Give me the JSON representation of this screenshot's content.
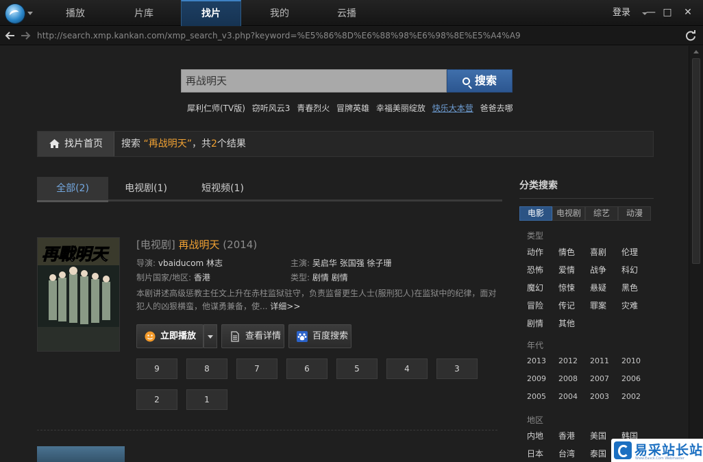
{
  "nav": {
    "tabs": [
      "播放",
      "片库",
      "找片",
      "我的",
      "云播"
    ],
    "active": "找片",
    "login": "登录"
  },
  "window_controls": {
    "minimize": "—",
    "maximize": "□",
    "close": "✕"
  },
  "address": {
    "url": "http://search.xmp.kankan.com/xmp_search_v3.php?keyword=%E5%86%8D%E6%88%98%E6%98%8E%E5%A4%A9"
  },
  "search": {
    "value": "再战明天",
    "button": "搜索",
    "hotwords": [
      "犀利仁师(TV版)",
      "窃听风云3",
      "青春烈火",
      "冒牌英雄",
      "幸福美丽绽放",
      "快乐大本营",
      "爸爸去哪"
    ],
    "hotword_link": "快乐大本营"
  },
  "breadcrumb": {
    "home": "找片首页",
    "prefix": "搜索",
    "open_quote": "“",
    "keyword": "再战明天",
    "close_quote": "”",
    "middle": "，共",
    "count": "2",
    "suffix": "个结果"
  },
  "result_tabs": [
    {
      "label": "全部(2)",
      "active": true
    },
    {
      "label": "电视剧(1)",
      "active": false
    },
    {
      "label": "短视频(1)",
      "active": false
    }
  ],
  "result": {
    "category": "[电视剧]",
    "title": "再战明天",
    "year": "(2014)",
    "director_label": "导演:",
    "director": "vbaiducom 林志",
    "cast_label": "主演:",
    "cast": "吴启华 张国强 徐子珊",
    "region_label": "制片国家/地区:",
    "region": "香港",
    "type_label": "类型:",
    "type": "剧情 剧情",
    "description": "本剧讲述高级惩教主任文上升在赤柱监狱驻守，负责监督更生人士(服刑犯人)在监狱中的纪律，面对犯人的凶狠横蛮，他谋勇兼备，使...",
    "more": "详细>>",
    "poster_text": "再戰明天",
    "buttons": {
      "play": "立即播放",
      "details": "查看详情",
      "baidu": "百度搜索"
    },
    "episodes": [
      "9",
      "8",
      "7",
      "6",
      "5",
      "4",
      "3",
      "2",
      "1"
    ]
  },
  "sidebar": {
    "title": "分类搜索",
    "tabs": [
      "电影",
      "电视剧",
      "综艺",
      "动漫"
    ],
    "active_tab": "电影",
    "type_label": "类型",
    "types": [
      "动作",
      "情色",
      "喜剧",
      "伦理",
      "恐怖",
      "爱情",
      "战争",
      "科幻",
      "魔幻",
      "惊悚",
      "悬疑",
      "黑色",
      "冒险",
      "传记",
      "罪案",
      "灾难",
      "剧情",
      "其他"
    ],
    "year_label": "年代",
    "years": [
      "2013",
      "2012",
      "2011",
      "2010",
      "2009",
      "2008",
      "2007",
      "2006",
      "2005",
      "2004",
      "2003",
      "2002"
    ],
    "region_label": "地区",
    "regions": [
      "内地",
      "香港",
      "美国",
      "韩国",
      "日本",
      "台湾",
      "泰国"
    ]
  },
  "watermark": {
    "text": "易采站长站",
    "sub": "Www.Easck.Com Webmaster"
  },
  "colors": {
    "accent_blue": "#2c5690",
    "keyword_orange": "#f0a133",
    "active_tab_text": "#74a8e0"
  }
}
